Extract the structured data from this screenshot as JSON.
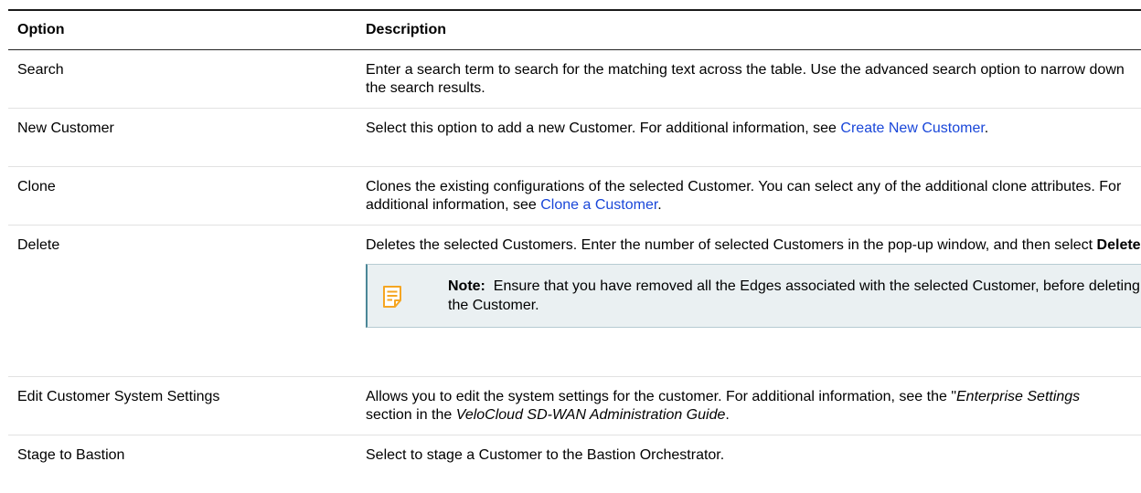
{
  "table": {
    "headers": {
      "option": "Option",
      "description": "Description"
    },
    "rows": [
      {
        "option": "Search",
        "desc_text": "Enter a search term to search for the matching text across the table. Use the advanced search option to narrow down the search results."
      },
      {
        "option": "New Customer",
        "desc_before": "Select this option to add a new Customer. For additional information, see ",
        "desc_link": "Create New Customer",
        "desc_after": "."
      },
      {
        "option": "Clone",
        "desc_before": "Clones the existing configurations of the selected Customer. You can select any of the additional clone attributes. For additional information, see ",
        "desc_link": "Clone a Customer",
        "desc_after": "."
      },
      {
        "option": "Delete",
        "desc_before": "Deletes the selected Customers. Enter the number of selected Customers in the pop-up window, and then select ",
        "desc_bold": "Delete",
        "desc_after": ".",
        "note": {
          "icon": "note-icon",
          "label": "Note:",
          "text": "Ensure that you have removed all the Edges associated with the selected Customer, before deleting the Customer."
        }
      },
      {
        "option": "Edit Customer System Settings",
        "desc_before": "Allows you to edit the system settings for the customer. For additional information, see the \"",
        "desc_italic1": "Enterprise Settings",
        "desc_middle": " section in the ",
        "desc_italic2": "VeloCloud SD-WAN Administration Guide",
        "desc_after": "."
      },
      {
        "option": "Stage to Bastion",
        "desc_text": "Select to stage a Customer to the Bastion Orchestrator."
      }
    ]
  },
  "colors": {
    "link": "#1a47d9",
    "note_background": "#eaf0f2",
    "note_border": "#4b8797",
    "note_icon": "#f5a623"
  }
}
